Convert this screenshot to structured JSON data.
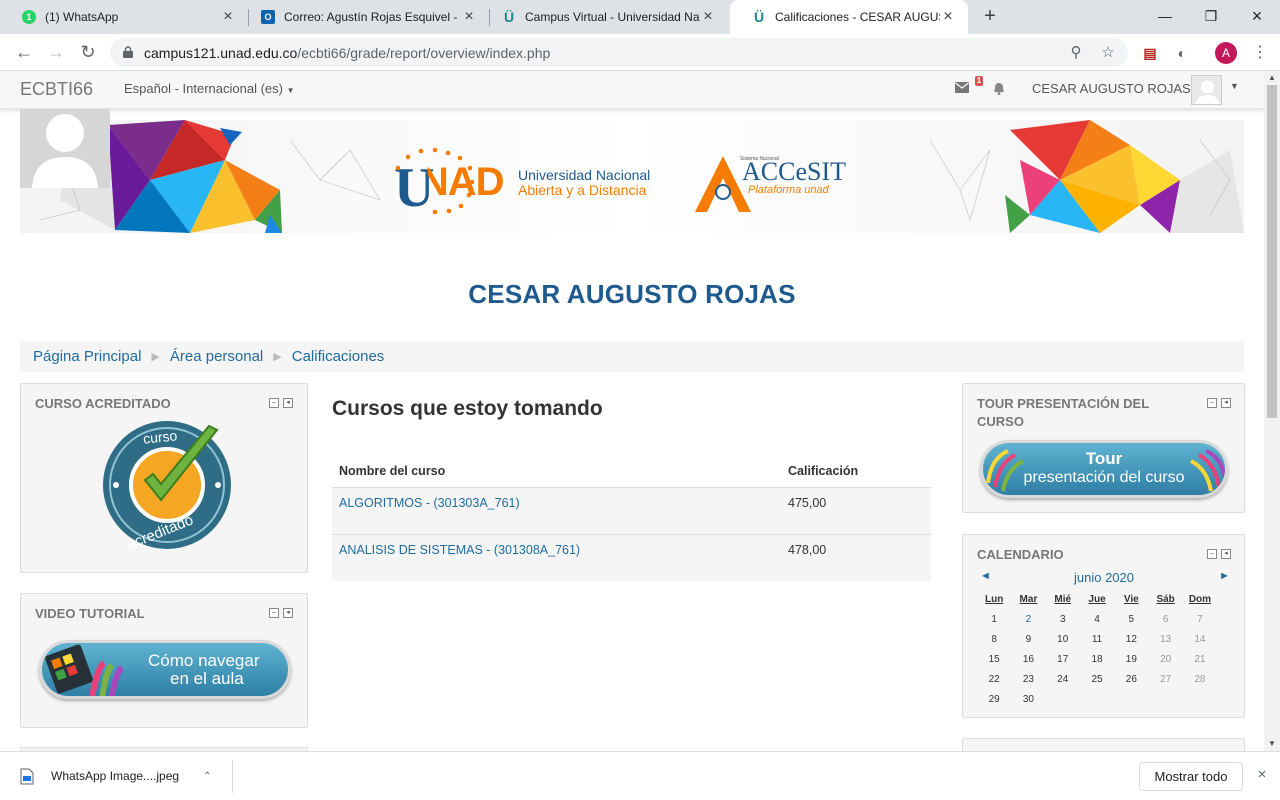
{
  "browser": {
    "tabs": [
      {
        "title": "(1) WhatsApp",
        "icon": "whatsapp-icon"
      },
      {
        "title": "Correo: Agustín Rojas Esquivel - O",
        "icon": "outlook-icon"
      },
      {
        "title": "Campus Virtual - Universidad Na",
        "icon": "unad-icon"
      },
      {
        "title": "Calificaciones - CESAR AUGUSTO",
        "icon": "unad-icon"
      }
    ],
    "url_host": "campus121.unad.edu.co",
    "url_path": "/ecbti66/grade/report/overview/index.php"
  },
  "navbar": {
    "brand": "ECBTI66",
    "language": "Español - Internacional (es)",
    "message_badge": "1",
    "username": "CESAR AUGUSTO ROJAS"
  },
  "banner": {
    "logo_text": "UNAD",
    "university_line1": "Universidad Nacional",
    "university_line2": "Abierta y a Distancia",
    "access_small": "Sistema Nacional",
    "access_title": "ACCeSIT",
    "access_subtitle": "Plataforma unad"
  },
  "page_title": "CESAR AUGUSTO ROJAS",
  "breadcrumb": [
    "Página Principal",
    "Área personal",
    "Calificaciones"
  ],
  "left_blocks": {
    "accredited": {
      "title": "CURSO ACREDITADO",
      "badge_top": "curso",
      "badge_bottom": "acreditado"
    },
    "video": {
      "title": "VIDEO TUTORIAL",
      "button_line1": "Cómo navegar",
      "button_line2": "en el aula"
    }
  },
  "main": {
    "heading": "Cursos que estoy tomando",
    "columns": [
      "Nombre del curso",
      "Calificación"
    ],
    "rows": [
      {
        "course": "ALGORITMOS - (301303A_761)",
        "grade": "475,00"
      },
      {
        "course": "ANALISIS DE SISTEMAS - (301308A_761)",
        "grade": "478,00"
      }
    ]
  },
  "right_blocks": {
    "tour": {
      "title_line1": "TOUR PRESENTACIÓN DEL",
      "title_line2": "CURSO",
      "button_line1": "Tour",
      "button_line2": "presentación del curso"
    },
    "calendar": {
      "title": "CALENDARIO",
      "month": "junio 2020",
      "prev": "◄",
      "next": "►",
      "day_headers": [
        "Lun",
        "Mar",
        "Mié",
        "Jue",
        "Vie",
        "Sáb",
        "Dom"
      ],
      "weeks": [
        [
          "1",
          "2",
          "3",
          "4",
          "5",
          "6",
          "7"
        ],
        [
          "8",
          "9",
          "10",
          "11",
          "12",
          "13",
          "14"
        ],
        [
          "15",
          "16",
          "17",
          "18",
          "19",
          "20",
          "21"
        ],
        [
          "22",
          "23",
          "24",
          "25",
          "26",
          "27",
          "28"
        ],
        [
          "29",
          "30",
          "",
          "",
          "",
          "",
          ""
        ]
      ]
    }
  },
  "downloads": {
    "file": "WhatsApp Image....jpeg",
    "show_all": "Mostrar todo"
  }
}
